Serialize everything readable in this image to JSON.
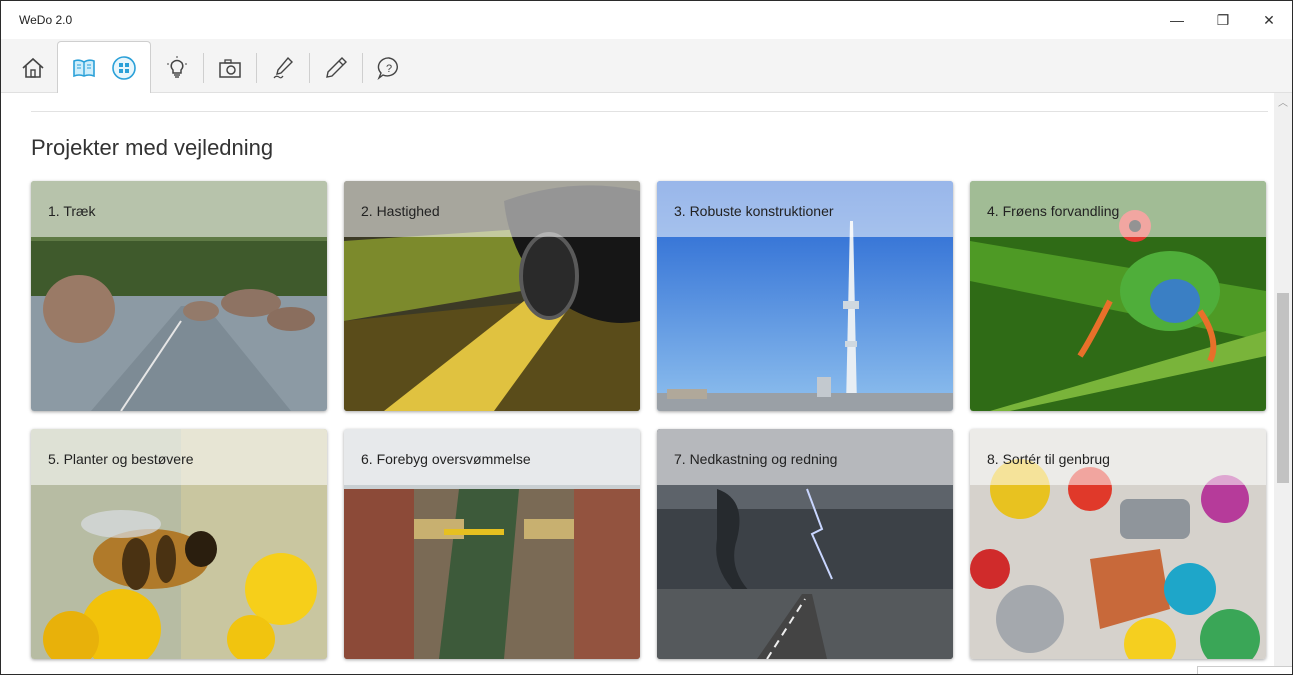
{
  "app": {
    "title": "WeDo 2.0"
  },
  "window_controls": {
    "minimize": "—",
    "restore": "❐",
    "close": "✕"
  },
  "toolbar": {
    "items": [
      {
        "icon": "home-icon"
      },
      {
        "icon": "book-icon"
      },
      {
        "icon": "grid-icon"
      },
      {
        "icon": "lightbulb-icon"
      },
      {
        "icon": "camera-icon"
      },
      {
        "icon": "pen-icon"
      },
      {
        "icon": "pencil-icon"
      },
      {
        "icon": "help-icon"
      }
    ]
  },
  "main": {
    "heading": "Projekter med vejledning",
    "cards": [
      {
        "label": "1. Træk"
      },
      {
        "label": "2. Hastighed"
      },
      {
        "label": "3. Robuste konstruktioner"
      },
      {
        "label": "4. Frøens forvandling"
      },
      {
        "label": "5. Planter og bestøvere"
      },
      {
        "label": "6. Forebyg oversvømmelse"
      },
      {
        "label": "7. Nedkastning og redning"
      },
      {
        "label": "8. Sortér til genbrug"
      }
    ]
  },
  "colors": {
    "accent": "#2aa0d8",
    "toolbar_bg": "#f4f4f4"
  }
}
